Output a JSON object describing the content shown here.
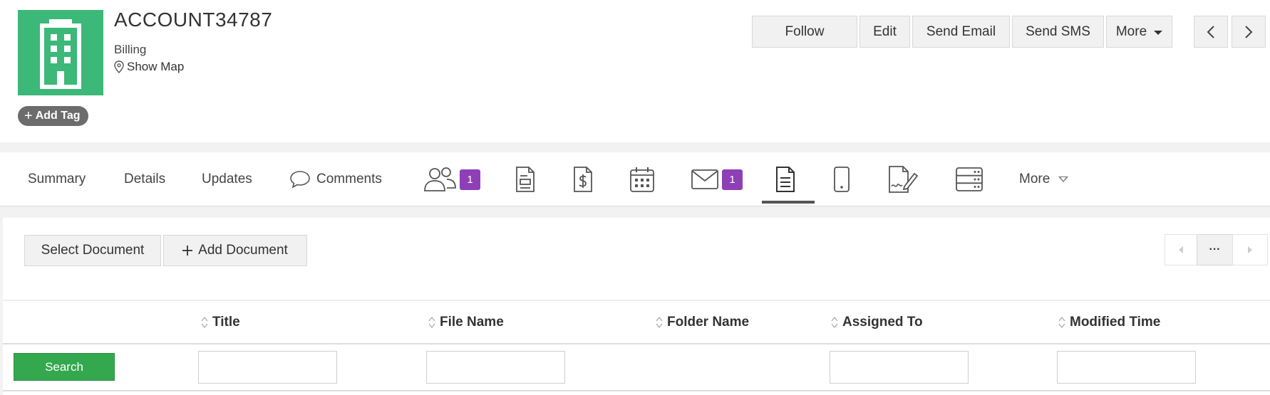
{
  "header": {
    "title": "ACCOUNT34787",
    "subtitle": "Billing",
    "show_map": "Show Map",
    "add_tag": "Add Tag",
    "avatar_color": "#3cb878",
    "avatar_icon": "building-icon"
  },
  "actions": {
    "follow": "Follow",
    "edit": "Edit",
    "send_email": "Send Email",
    "send_sms": "Send SMS",
    "more": "More"
  },
  "tabs": {
    "summary": "Summary",
    "details": "Details",
    "updates": "Updates",
    "comments": "Comments",
    "contacts_count": "1",
    "emails_count": "1",
    "more": "More",
    "icons": [
      "contacts-icon",
      "quote-icon",
      "invoice-icon",
      "calendar-icon",
      "email-icon",
      "document-icon",
      "mobile-icon",
      "signature-icon",
      "server-icon"
    ],
    "active": "document-icon"
  },
  "documents": {
    "select_document": "Select Document",
    "add_document": "Add Document",
    "pager_more": "···",
    "columns": [
      "Title",
      "File Name",
      "Folder Name",
      "Assigned To",
      "Modified Time"
    ],
    "search": "Search",
    "search_color": "#34a84e"
  }
}
